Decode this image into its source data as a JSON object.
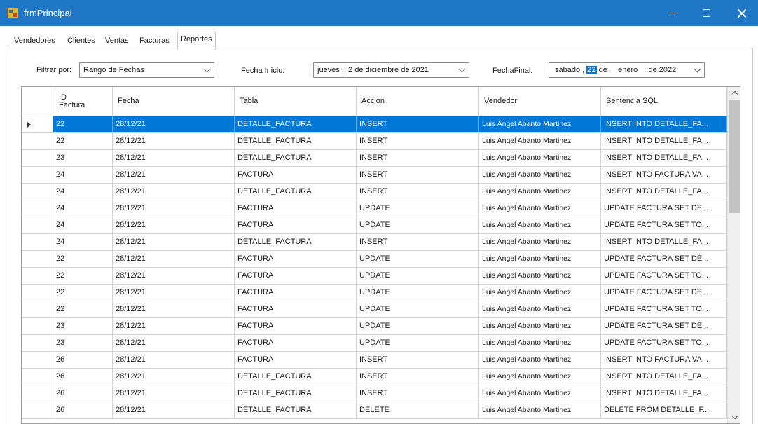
{
  "window": {
    "title": "frmPrincipal"
  },
  "tabs": [
    {
      "label": "Vendedores"
    },
    {
      "label": "Clientes"
    },
    {
      "label": "Ventas"
    },
    {
      "label": "Facturas"
    },
    {
      "label": "Reportes",
      "active": true
    }
  ],
  "filter": {
    "label": "Filtrar por:",
    "value": "Rango de Fechas"
  },
  "fecha_inicio": {
    "label": "Fecha Inicio:",
    "value": "jueves ,  2 de diciembre de 2021"
  },
  "fecha_final": {
    "label": "FechaFinal:",
    "weekday": "sábado ,",
    "day": "22",
    "rest": "de     enero     de 2022"
  },
  "grid": {
    "columns": [
      "ID\nFactura",
      "Fecha",
      "Tabla",
      "Accion",
      "Vendedor",
      "Sentencia SQL"
    ],
    "selected_row": 0,
    "rows": [
      [
        "22",
        "28/12/21",
        "DETALLE_FACTURA",
        "INSERT",
        "Luis Angel Abanto Martinez",
        "INSERT INTO DETALLE_FA..."
      ],
      [
        "22",
        "28/12/21",
        "DETALLE_FACTURA",
        "INSERT",
        "Luis Angel Abanto Martinez",
        "INSERT INTO DETALLE_FA..."
      ],
      [
        "23",
        "28/12/21",
        "DETALLE_FACTURA",
        "INSERT",
        "Luis Angel Abanto Martinez",
        "INSERT INTO DETALLE_FA..."
      ],
      [
        "24",
        "28/12/21",
        "FACTURA",
        "INSERT",
        "Luis Angel Abanto Martinez",
        "INSERT INTO FACTURA VA..."
      ],
      [
        "24",
        "28/12/21",
        "DETALLE_FACTURA",
        "INSERT",
        "Luis Angel Abanto Martinez",
        "INSERT INTO DETALLE_FA..."
      ],
      [
        "24",
        "28/12/21",
        "FACTURA",
        "UPDATE",
        "Luis Angel Abanto Martinez",
        "UPDATE FACTURA SET DE..."
      ],
      [
        "24",
        "28/12/21",
        "FACTURA",
        "UPDATE",
        "Luis Angel Abanto Martinez",
        "UPDATE FACTURA SET TO..."
      ],
      [
        "24",
        "28/12/21",
        "DETALLE_FACTURA",
        "INSERT",
        "Luis Angel Abanto Martinez",
        "INSERT INTO DETALLE_FA..."
      ],
      [
        "22",
        "28/12/21",
        "FACTURA",
        "UPDATE",
        "Luis Angel Abanto Martinez",
        "UPDATE FACTURA SET DE..."
      ],
      [
        "22",
        "28/12/21",
        "FACTURA",
        "UPDATE",
        "Luis Angel Abanto Martinez",
        "UPDATE FACTURA SET TO..."
      ],
      [
        "22",
        "28/12/21",
        "FACTURA",
        "UPDATE",
        "Luis Angel Abanto Martinez",
        "UPDATE FACTURA SET DE..."
      ],
      [
        "22",
        "28/12/21",
        "FACTURA",
        "UPDATE",
        "Luis Angel Abanto Martinez",
        "UPDATE FACTURA SET TO..."
      ],
      [
        "23",
        "28/12/21",
        "FACTURA",
        "UPDATE",
        "Luis Angel Abanto Martinez",
        "UPDATE FACTURA SET DE..."
      ],
      [
        "23",
        "28/12/21",
        "FACTURA",
        "UPDATE",
        "Luis Angel Abanto Martinez",
        "UPDATE FACTURA SET TO..."
      ],
      [
        "26",
        "28/12/21",
        "FACTURA",
        "INSERT",
        "Luis Angel Abanto Martinez",
        "INSERT INTO FACTURA VA..."
      ],
      [
        "26",
        "28/12/21",
        "DETALLE_FACTURA",
        "INSERT",
        "Luis Angel Abanto Martinez",
        "INSERT INTO DETALLE_FA..."
      ],
      [
        "26",
        "28/12/21",
        "DETALLE_FACTURA",
        "INSERT",
        "Luis Angel Abanto Martinez",
        "INSERT INTO DETALLE_FA..."
      ],
      [
        "26",
        "28/12/21",
        "DETALLE_FACTURA",
        "DELETE",
        "Luis Angel Abanto Martinez",
        "DELETE FROM DETALLE_F..."
      ]
    ]
  },
  "colors": {
    "titlebar": "#1f76c4",
    "selection": "#0078d7"
  }
}
